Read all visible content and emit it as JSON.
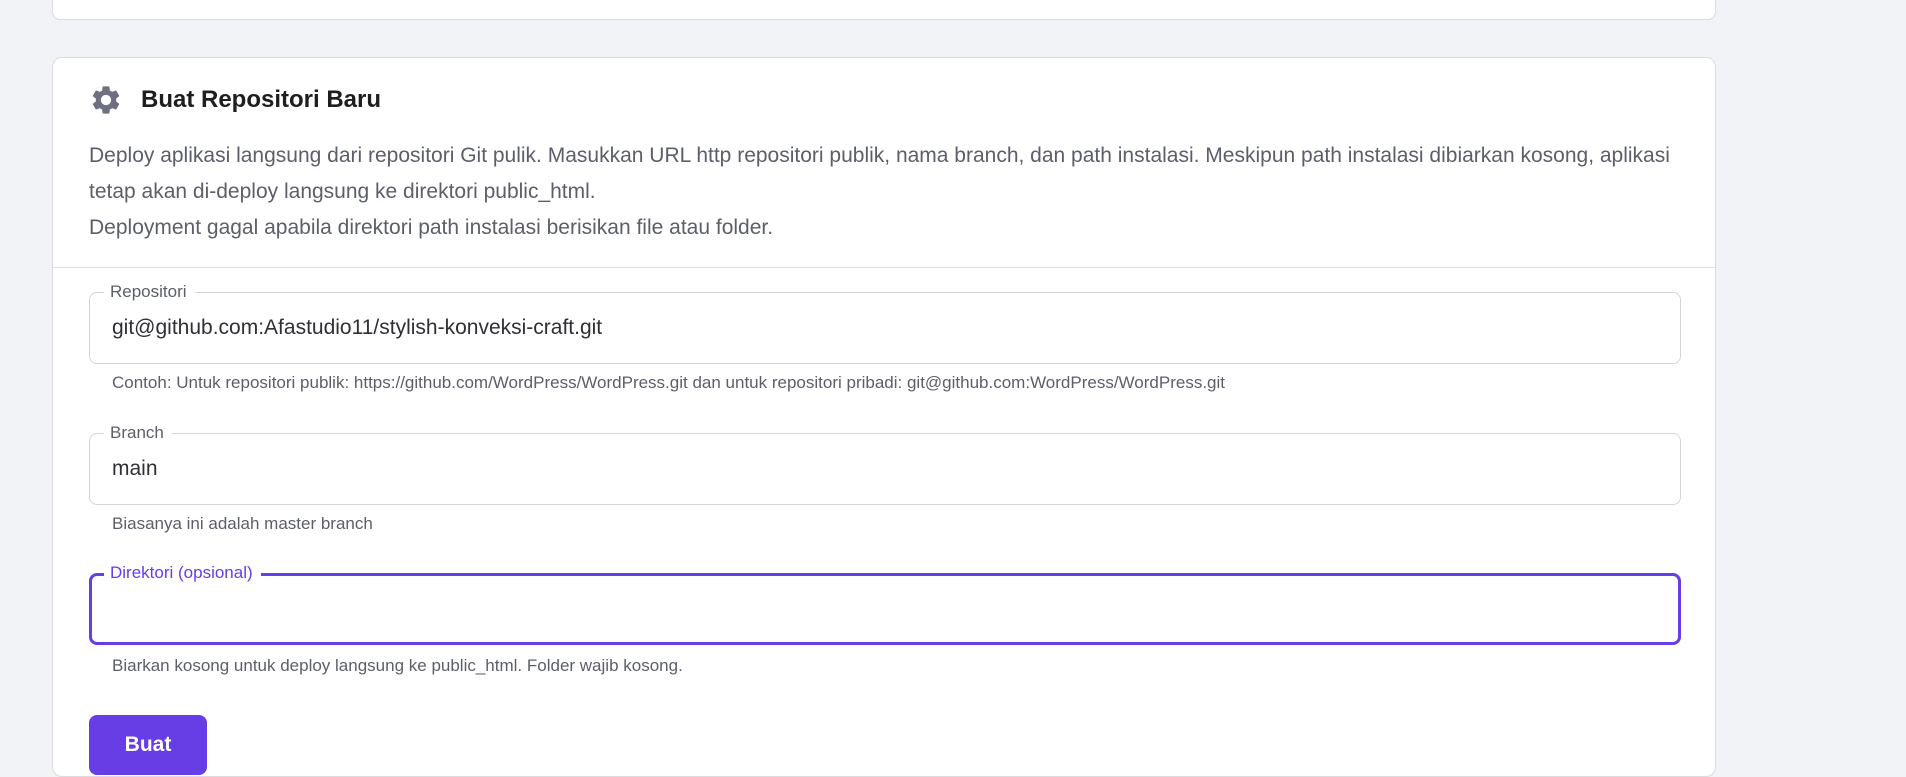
{
  "card": {
    "title": "Buat Repositori Baru",
    "icon": "gear-icon",
    "description": [
      "Deploy aplikasi langsung dari repositori Git pulik. Masukkan URL http repositori publik, nama branch, dan path instalasi. Meskipun path instalasi dibiarkan kosong, aplikasi tetap akan di-deploy langsung ke direktori public_html.",
      "Deployment gagal apabila direktori path instalasi berisikan file atau folder."
    ]
  },
  "form": {
    "repository": {
      "label": "Repositori",
      "value": "git@github.com:Afastudio11/stylish-konveksi-craft.git",
      "hint": "Contoh: Untuk repositori publik: https://github.com/WordPress/WordPress.git dan untuk repositori pribadi: git@github.com:WordPress/WordPress.git"
    },
    "branch": {
      "label": "Branch",
      "value": "main",
      "hint": "Biasanya ini adalah master branch"
    },
    "directory": {
      "label": "Direktori (opsional)",
      "value": "",
      "hint": "Biarkan kosong untuk deploy langsung ke public_html. Folder wajib kosong."
    },
    "submit_label": "Buat"
  },
  "colors": {
    "accent": "#673de6",
    "background": "#f2f3f6",
    "muted_text": "#5c5f6a"
  }
}
